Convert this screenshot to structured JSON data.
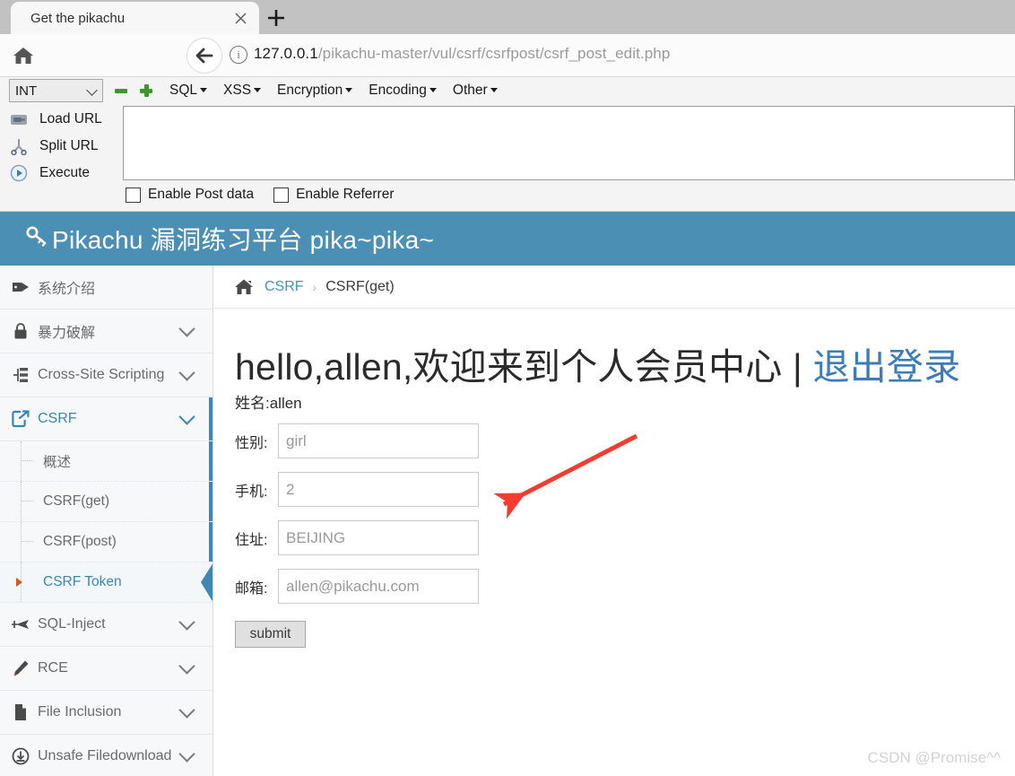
{
  "browser": {
    "tab_title": "Get the pikachu",
    "tab_close_label": "×",
    "new_tab_label": "+",
    "home_icon": "home-icon",
    "back_icon": "back-arrow-icon",
    "info_icon": "info-icon",
    "url_host": "127.0.0.1",
    "url_path": "/pikachu-master/vul/csrf/csrfpost/csrf_post_edit.php"
  },
  "hackbar": {
    "type_select_value": "INT",
    "minus_label": "minus-icon",
    "plus_label": "plus-icon",
    "menus": [
      {
        "label": "SQL"
      },
      {
        "label": "XSS"
      },
      {
        "label": "Encryption"
      },
      {
        "label": "Encoding"
      },
      {
        "label": "Other"
      }
    ],
    "actions": [
      {
        "label": "Load URL",
        "icon": "load-url-icon"
      },
      {
        "label": "Split URL",
        "icon": "split-url-icon"
      },
      {
        "label": "Execute",
        "icon": "execute-icon"
      }
    ],
    "textarea_value": "",
    "checkboxes": [
      {
        "label": "Enable Post data",
        "checked": false
      },
      {
        "label": "Enable Referrer",
        "checked": false
      }
    ]
  },
  "site": {
    "header_title": "Pikachu 漏洞练习平台 pika~pika~",
    "header_icon": "key-icon",
    "header_bg": "#4b8fb5"
  },
  "sidebar": {
    "items": [
      {
        "label": "系统介绍",
        "icon": "tag-icon",
        "has_chevron": false,
        "active": false
      },
      {
        "label": "暴力破解",
        "icon": "lock-icon",
        "has_chevron": true,
        "active": false
      },
      {
        "label": "Cross-Site Scripting",
        "icon": "sitemap-icon",
        "has_chevron": true,
        "active": false
      },
      {
        "label": "CSRF",
        "icon": "external-link-icon",
        "has_chevron": true,
        "active": true
      }
    ],
    "sub_items": [
      {
        "label": "概述",
        "active": false
      },
      {
        "label": "CSRF(get)",
        "active": false
      },
      {
        "label": "CSRF(post)",
        "active": false
      },
      {
        "label": "CSRF Token",
        "active": true
      }
    ],
    "items_after": [
      {
        "label": "SQL-Inject",
        "icon": "plane-icon",
        "has_chevron": true,
        "active": false
      },
      {
        "label": "RCE",
        "icon": "pencil-icon",
        "has_chevron": true,
        "active": false
      },
      {
        "label": "File Inclusion",
        "icon": "file-icon",
        "has_chevron": true,
        "active": false
      },
      {
        "label": "Unsafe Filedownload",
        "icon": "download-circle-icon",
        "has_chevron": true,
        "active": false
      }
    ]
  },
  "breadcrumb": {
    "home_icon": "home-icon",
    "parent": "CSRF",
    "separator": "›",
    "current": "CSRF(get)"
  },
  "main": {
    "greeting_prefix": "hello,allen,欢迎来到个人会员中心",
    "greeting_divider": "|",
    "logout_label": "退出登录",
    "name_line": "姓名:allen",
    "fields": [
      {
        "label": "性别:",
        "value": "girl"
      },
      {
        "label": "手机:",
        "value": "2"
      },
      {
        "label": "住址:",
        "value": "BEIJING"
      },
      {
        "label": "邮箱:",
        "value": "allen@pikachu.com"
      }
    ],
    "submit_label": "submit",
    "annotation_arrow_color": "#f43d32"
  },
  "watermark": "CSDN @Promise^^"
}
